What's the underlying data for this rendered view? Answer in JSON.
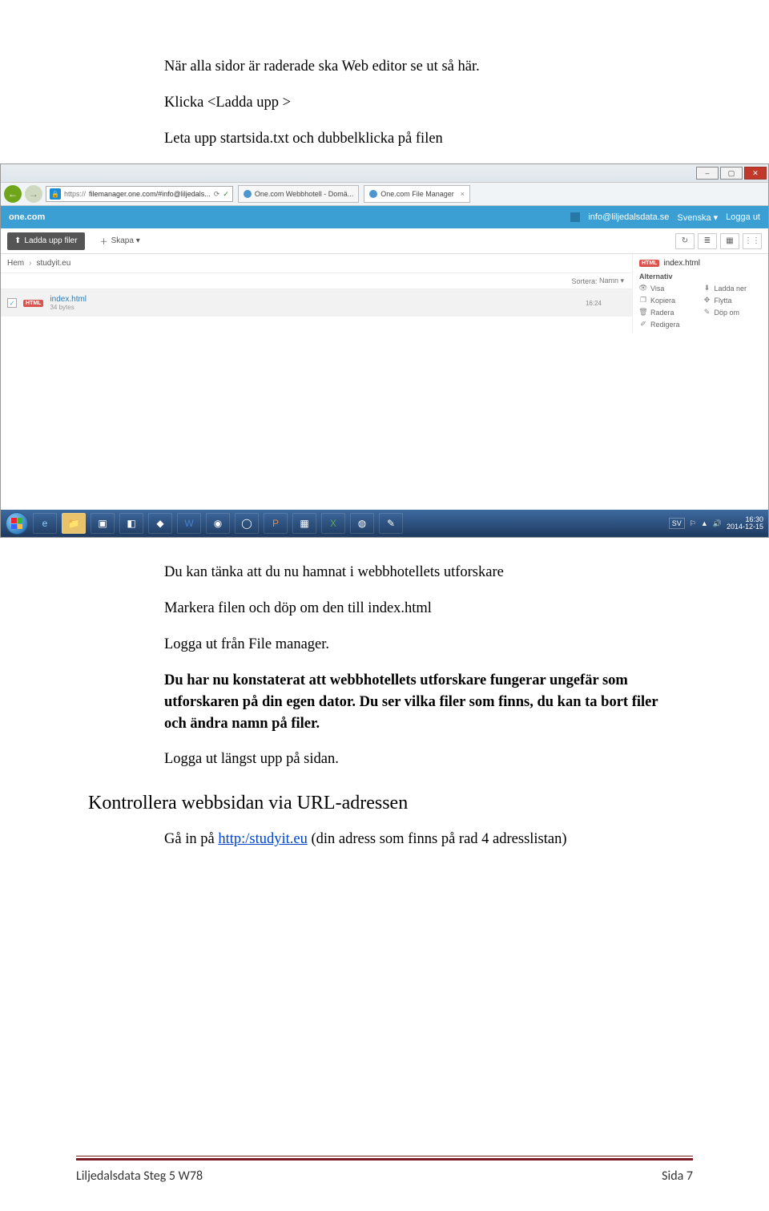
{
  "text": {
    "p1": "När alla sidor är raderade ska Web editor se ut så här.",
    "p2": "Klicka <Ladda upp >",
    "p3": "Leta upp startsida.txt och dubbelklicka på filen",
    "p4": "Du kan tänka att du nu hamnat i webbhotellets utforskare",
    "p5": "Markera filen och döp om den till index.html",
    "p6": "Logga ut från File manager.",
    "p7": "Du har nu konstaterat att webbhotellets utforskare fungerar ungefär som utforskaren på din egen dator. Du ser vilka filer som finns, du kan ta bort filer och ändra namn på filer.",
    "p8": "Logga ut  längst upp på sidan.",
    "h1": "Kontrollera webbsidan via URL-adressen",
    "p9a": "Gå in på ",
    "p9link": "http:/studyit.eu",
    "p9b": " (din adress som finns på rad 4 adresslistan)"
  },
  "screenshot": {
    "titlebar": {
      "min": "–",
      "max": "▢",
      "close": "✕"
    },
    "addr": {
      "back_glyph": "←",
      "fwd_glyph": "→",
      "url_prefix": "https://",
      "url_rest": "filemanager.one.com/#info@liljedals...",
      "lock_glyph": "🔒",
      "refresh_glyph": "⟳",
      "cert_glyph": "✓"
    },
    "tabs": [
      {
        "label": "One.com Webbhotell - Domä...",
        "active": false
      },
      {
        "label": "One.com File Manager",
        "active": true
      }
    ],
    "banner": {
      "brand": "one.com",
      "user": "info@liljedalsdata.se",
      "language": "Svenska ▾",
      "logout": "Logga ut"
    },
    "toolbar": {
      "upload_icon": "⬆",
      "upload_label": "Ladda upp filer",
      "create_icon": "＋",
      "create_label": "Skapa ▾",
      "reload_glyph": "↻",
      "view1": "≣",
      "view2": "▦",
      "view3": "⋮⋮"
    },
    "breadcrumb": {
      "home": "Hem",
      "sep": "›",
      "folder": "studyit.eu"
    },
    "sort": {
      "label": "Sortera:",
      "value": "Namn ▾"
    },
    "file": {
      "badge": "HTML",
      "name": "index.html",
      "size": "34 bytes",
      "time": "16:24",
      "checked": "✓"
    },
    "side": {
      "badge": "HTML",
      "name": "index.html",
      "alt_title": "Alternativ",
      "visa": "Visa",
      "ladda_ner": "Ladda ner",
      "kopiera": "Kopiera",
      "flytta": "Flytta",
      "radera": "Radera",
      "dop_om": "Döp om",
      "redigera": "Redigera",
      "i_visa": "👁",
      "i_ladda": "⬇",
      "i_kop": "❐",
      "i_flytta": "✥",
      "i_radera": "🗑",
      "i_dop": "✎",
      "i_red": "✐"
    },
    "taskbar": {
      "lang": "SV",
      "time": "16:30",
      "date": "2014-12-15",
      "flag_glyph": "⚐",
      "tray1": "▲",
      "tray2": "🔊"
    }
  },
  "footer": {
    "left": "Liljedalsdata Steg 5 W78",
    "right": "Sida 7"
  }
}
